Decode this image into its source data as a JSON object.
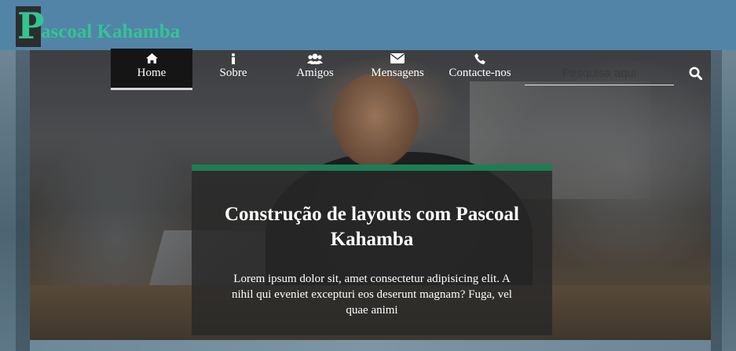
{
  "brand": {
    "initial": "P",
    "rest": "ascoal Kahamba",
    "color": "#34c492"
  },
  "nav": {
    "items": [
      {
        "label": "Home",
        "icon": "home-icon",
        "active": true
      },
      {
        "label": "Sobre",
        "icon": "info-icon",
        "active": false
      },
      {
        "label": "Amigos",
        "icon": "users-icon",
        "active": false
      },
      {
        "label": "Mensagens",
        "icon": "envelope-icon",
        "active": false
      },
      {
        "label": "Contacte-nos",
        "icon": "phone-icon",
        "active": false
      }
    ]
  },
  "search": {
    "placeholder": "Pesquisa aqui",
    "button_icon": "search-icon"
  },
  "hero": {
    "title": "Construção de layouts com Pascoal Kahamba",
    "text": "Lorem ipsum dolor sit, amet consectetur adipisicing elit. A nihil qui eveniet excepturi eos deserunt magnam? Fuga, vel quae animi",
    "accent_color": "#1e7d55"
  }
}
